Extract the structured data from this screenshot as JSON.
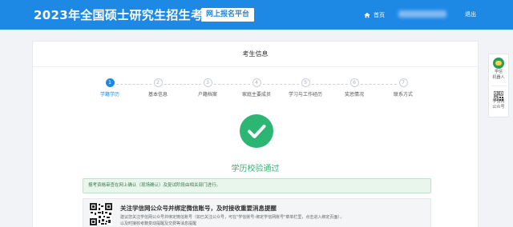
{
  "header": {
    "title": "2023年全国硕士研究生招生考试",
    "platform_label": "网上报名平台",
    "home_label": "首页",
    "logout_label": "退出"
  },
  "card": {
    "title": "考生信息"
  },
  "steps": [
    {
      "number": "1",
      "label": "学籍学历",
      "active": true
    },
    {
      "number": "2",
      "label": "基本信息",
      "active": false
    },
    {
      "number": "3",
      "label": "户籍档案",
      "active": false
    },
    {
      "number": "4",
      "label": "家庭主要成员",
      "active": false
    },
    {
      "number": "5",
      "label": "学习与工作经历",
      "active": false
    },
    {
      "number": "6",
      "label": "奖惩情况",
      "active": false
    },
    {
      "number": "7",
      "label": "联系方式",
      "active": false
    }
  ],
  "success": {
    "text": "学历校验通过"
  },
  "notice": {
    "text": "报考资格审查在网上确认（现场确认）及复试阶段由相关部门进行。"
  },
  "wechat": {
    "title": "关注学信网公众号并绑定微信账号，及时接收重要消息提醒",
    "desc_line1": "建议您关注学信网公众号并绑定微信账号（如已关注公众号，可在\"学信账号-绑定学信网账号\"菜单栏里，点击进入绑定页面），",
    "desc_line2": "以及时接收考籍变动提醒及交费等消息提醒"
  },
  "side": {
    "robot_label_1": "学信",
    "robot_label_2": "机器人",
    "qr_label_1": "学信网",
    "qr_label_2": "公众号"
  },
  "colors": {
    "brand": "#1e88e5",
    "success": "#2bb673"
  }
}
